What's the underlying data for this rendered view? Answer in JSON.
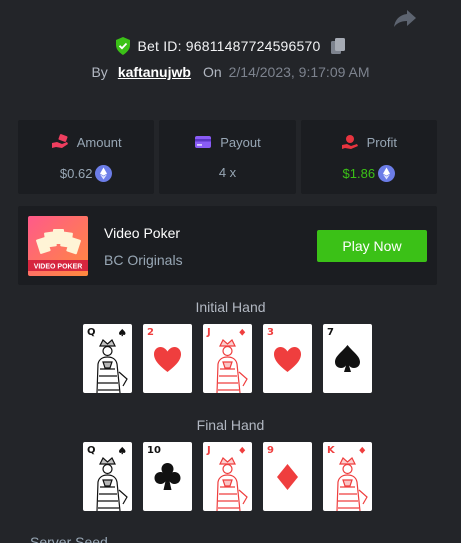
{
  "header": {
    "bet_id_label": "Bet ID: 96811487724596570",
    "by_label": "By",
    "username": "kaftanujwb",
    "on_label": "On",
    "date": "2/14/2023, 9:17:09 AM"
  },
  "stats": [
    {
      "label": "Amount",
      "value": "$0.62",
      "icon": "money-hand-icon",
      "coin": "eth-coin-icon"
    },
    {
      "label": "Payout",
      "value": "4 x",
      "icon": "card-wallet-icon"
    },
    {
      "label": "Profit",
      "value": "$1.86",
      "icon": "profit-hand-icon",
      "coin": "eth-coin-icon"
    }
  ],
  "game": {
    "name": "Video Poker",
    "provider": "BC Originals",
    "thumb_text": "VIDEO POKER",
    "play_label": "Play Now"
  },
  "initial_hand": {
    "title": "Initial Hand",
    "cards": [
      {
        "rank": "Q",
        "suit": "spades"
      },
      {
        "rank": "2",
        "suit": "hearts"
      },
      {
        "rank": "J",
        "suit": "diamonds"
      },
      {
        "rank": "3",
        "suit": "hearts"
      },
      {
        "rank": "7",
        "suit": "spades"
      }
    ]
  },
  "final_hand": {
    "title": "Final Hand",
    "cards": [
      {
        "rank": "Q",
        "suit": "spades"
      },
      {
        "rank": "10",
        "suit": "clubs"
      },
      {
        "rank": "J",
        "suit": "diamonds"
      },
      {
        "rank": "9",
        "suit": "diamonds"
      },
      {
        "rank": "K",
        "suit": "diamonds"
      }
    ]
  },
  "server_seed_label": "Server Seed",
  "colors": {
    "background": "#232529",
    "panel": "#1b1d21",
    "accent_green": "#3bc117",
    "red_suit": "#ef3e3e",
    "shield_green": "#3bc117"
  }
}
